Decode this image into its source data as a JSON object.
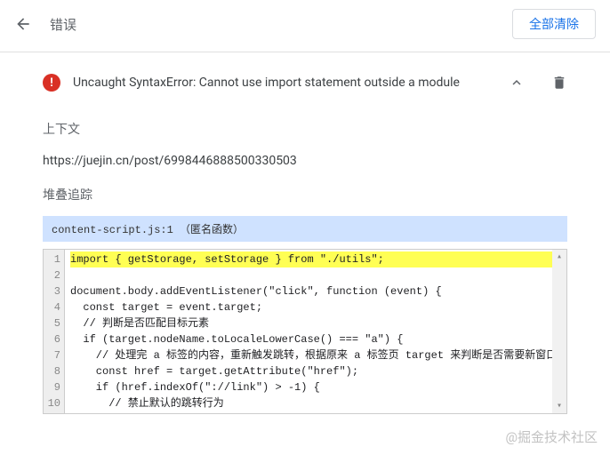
{
  "header": {
    "title": "错误",
    "clear_all": "全部清除"
  },
  "error": {
    "message": "Uncaught SyntaxError: Cannot use import statement outside a module"
  },
  "context": {
    "label": "上下文",
    "url": "https://juejin.cn/post/6998446888500330503"
  },
  "stack": {
    "label": "堆叠追踪",
    "source": "content-script.js:1 （匿名函数）"
  },
  "code": {
    "lines": [
      "import { getStorage, setStorage } from \"./utils\";",
      "",
      "document.body.addEventListener(\"click\", function (event) {",
      "  const target = event.target;",
      "  // 判断是否匹配目标元素",
      "  if (target.nodeName.toLocaleLowerCase() === \"a\") {",
      "    // 处理完 a 标签的内容，重新触发跳转，根据原来 a 标签页 target 来判断是否需要新窗口打开",
      "    const href = target.getAttribute(\"href\");",
      "    if (href.indexOf(\"://link\") > -1) {",
      "      // 禁止默认的跳转行为"
    ],
    "highlight_index": 0,
    "line_numbers": [
      "1",
      "2",
      "3",
      "4",
      "5",
      "6",
      "7",
      "8",
      "9",
      "10"
    ]
  },
  "watermark": "@掘金技术社区"
}
